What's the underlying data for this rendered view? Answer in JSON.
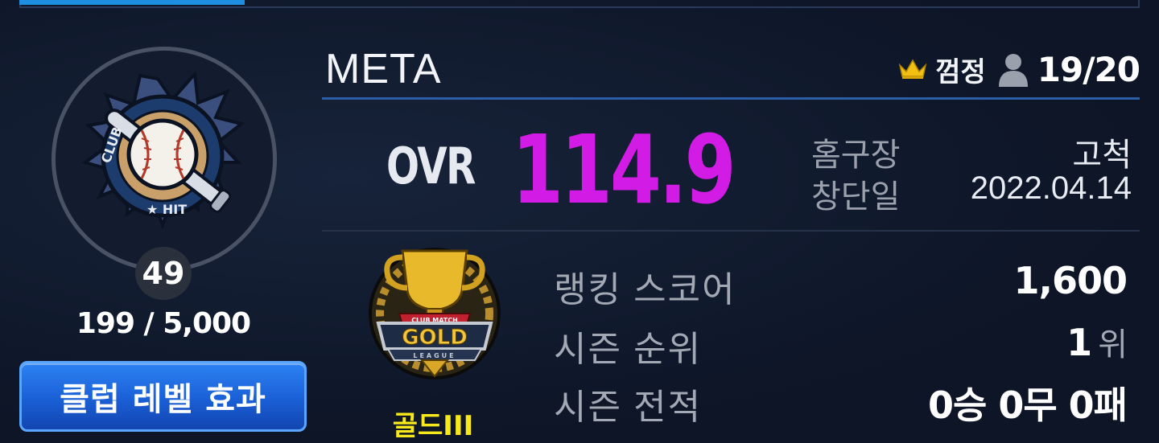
{
  "club": {
    "name": "META",
    "owner": "껌정",
    "members": "19/20"
  },
  "emblem": {
    "text": "CLUB HIT",
    "icon": "baseball-club-emblem"
  },
  "level": {
    "value": "49",
    "exp": "199 / 5,000",
    "effect_button": "클럽 레벨 효과"
  },
  "ovr": {
    "label": "OVR",
    "value": "114.9",
    "color": "#d21ce6"
  },
  "info": {
    "home_label": "홈구장",
    "home_value": "고척",
    "founded_label": "창단일",
    "founded_value": "2022.04.14"
  },
  "league": {
    "name": "골드III",
    "badge_top": "CLUB MATCH",
    "badge_main": "GOLD",
    "badge_bottom": "LEAGUE",
    "color": "#f6e81a"
  },
  "stats": {
    "ranking_label": "랭킹 스코어",
    "ranking_value": "1,600",
    "season_rank_label": "시즌 순위",
    "season_rank_value": "1",
    "season_rank_unit": "위",
    "season_record_label": "시즌 전적",
    "season_record_value": "0승 0무 0패"
  }
}
